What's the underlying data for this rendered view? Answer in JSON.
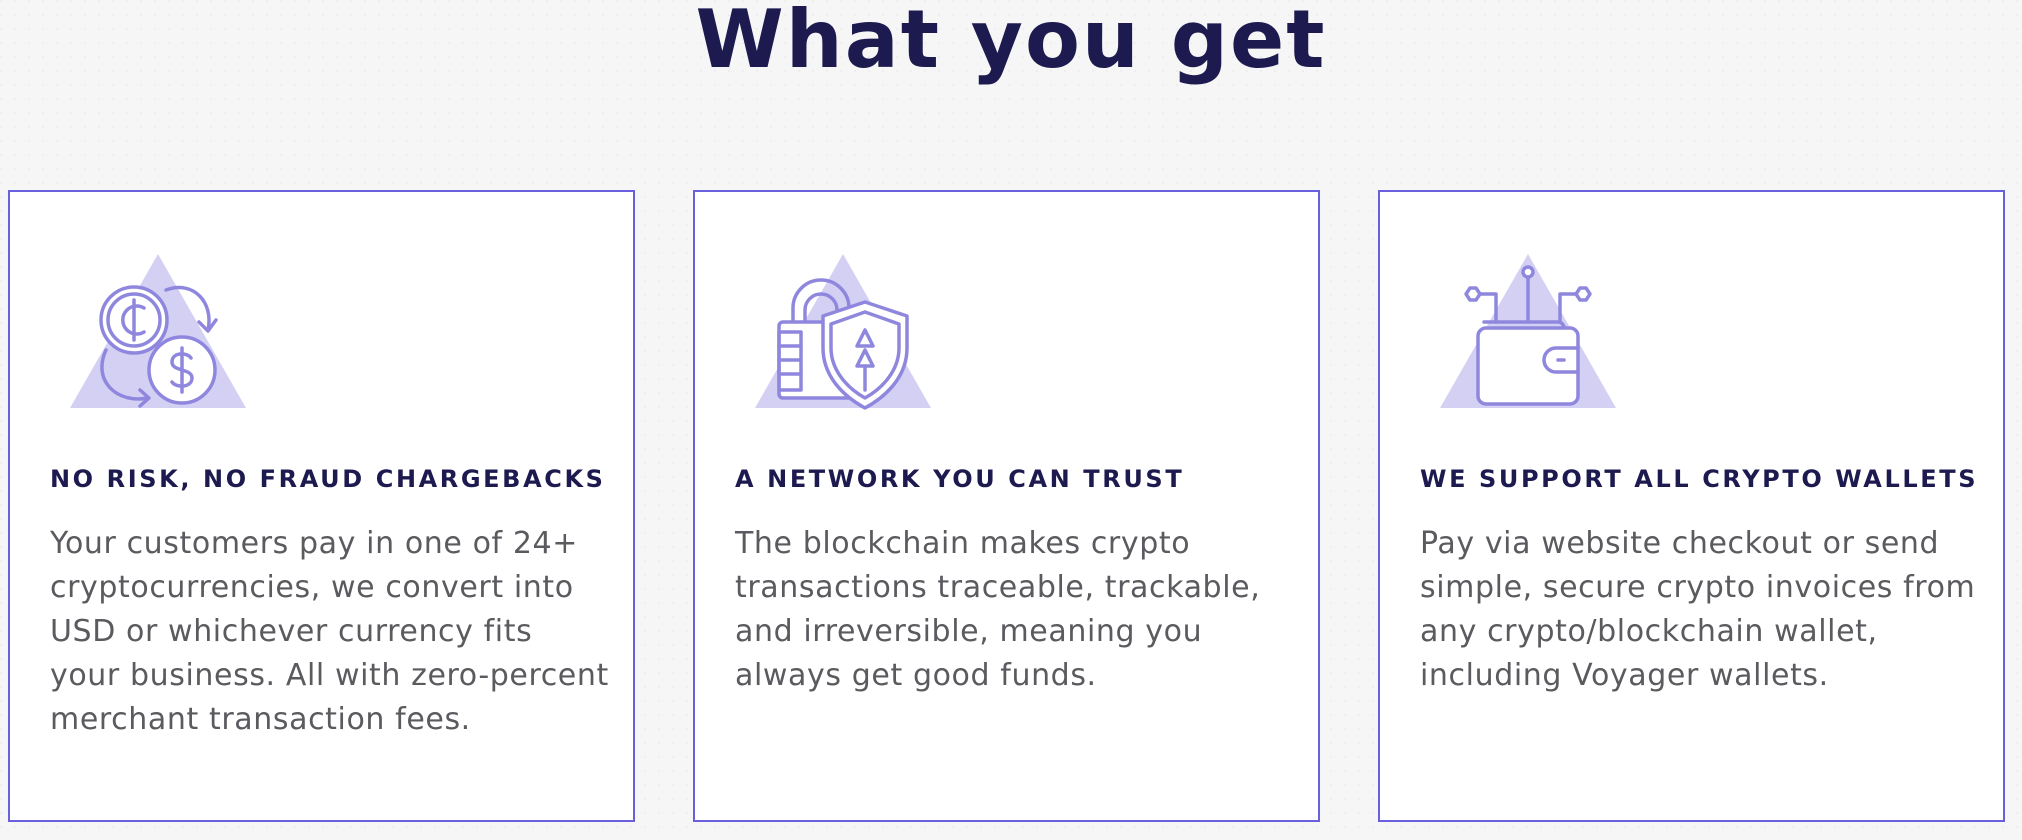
{
  "section": {
    "title": "What you get"
  },
  "colors": {
    "heading": "#1d1a4f",
    "card_border": "#6a60de",
    "icon_fill": "#d3d0f4",
    "icon_stroke": "#8f87de",
    "body_text": "#5a5a5f"
  },
  "cards": [
    {
      "icon": "currency-exchange-icon",
      "heading": "NO RISK, NO FRAUD CHARGEBACKS",
      "body": "Your customers pay in one of 24+ cryptocurrencies, we convert into USD or whichever currency fits your business. All with zero-percent merchant transaction fees."
    },
    {
      "icon": "secure-lock-shield-icon",
      "heading": "A NETWORK YOU CAN TRUST",
      "body": "The blockchain makes crypto transactions traceable, trackable, and irreversible, meaning you always get good funds."
    },
    {
      "icon": "crypto-wallet-icon",
      "heading": "WE SUPPORT ALL CRYPTO WALLETS",
      "body": "Pay via website checkout or send simple, secure crypto invoices from any crypto/blockchain wallet, including Voyager wallets."
    }
  ]
}
